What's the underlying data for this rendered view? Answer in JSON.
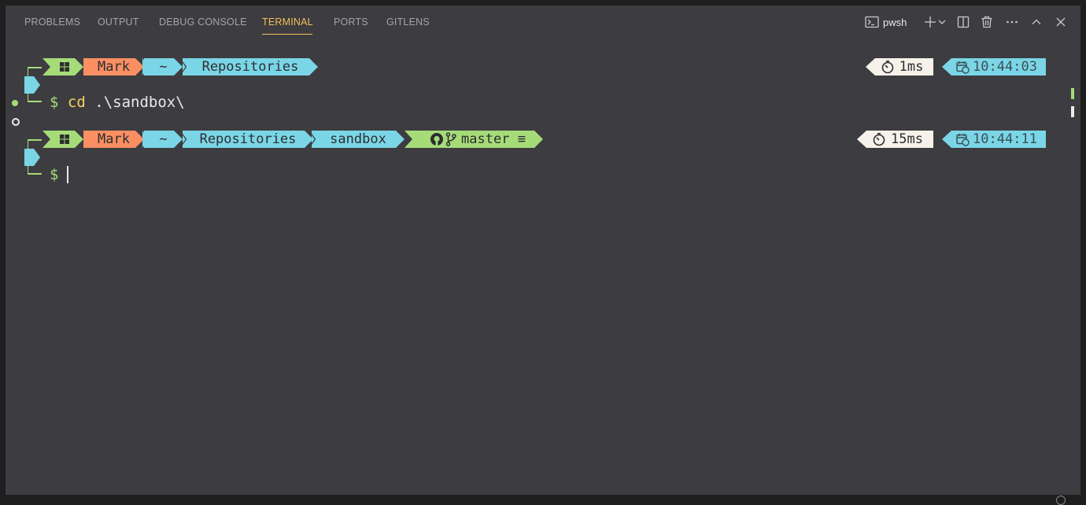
{
  "tabs": [
    {
      "label": "PROBLEMS"
    },
    {
      "label": "OUTPUT"
    },
    {
      "label": "DEBUG CONSOLE"
    },
    {
      "label": "TERMINAL",
      "active": true
    },
    {
      "label": "PORTS"
    },
    {
      "label": "GITLENS"
    }
  ],
  "toolbar": {
    "shell_name": "pwsh",
    "icons": [
      "terminal-icon",
      "plus-icon",
      "chevron-down-icon",
      "split-icon",
      "trash-icon",
      "more-icon",
      "chevron-up-icon",
      "close-icon"
    ]
  },
  "prompt1": {
    "user": "Mark",
    "home": "~",
    "dir": "Repositories",
    "duration": "1ms",
    "time": "10:44:03",
    "symbol": "$",
    "command": "cd",
    "argument": ".\\sandbox\\"
  },
  "prompt2": {
    "user": "Mark",
    "home": "~",
    "dir1": "Repositories",
    "dir2": "sandbox",
    "branch": "master ≡",
    "duration": "15ms",
    "time": "10:44:11",
    "symbol": "$"
  },
  "colors": {
    "panel_bg": "#3d3c40",
    "accent_active_tab": "#f0c15a",
    "segment_green": "#a5dc78",
    "segment_orange": "#f98f63",
    "segment_cyan": "#7ad6e6",
    "segment_white": "#f6f2ea",
    "command_yellow": "#f4d35e"
  }
}
